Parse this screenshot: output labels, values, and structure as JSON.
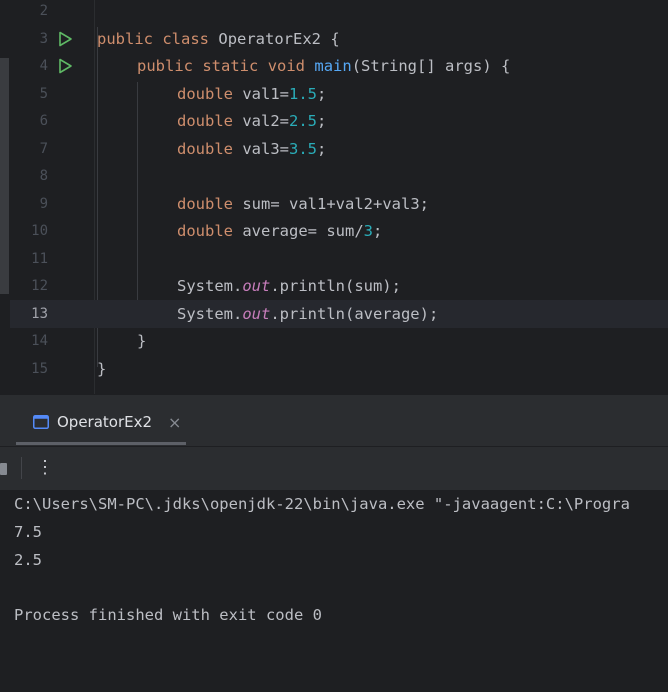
{
  "editor": {
    "lines": [
      {
        "n": "2"
      },
      {
        "n": "3"
      },
      {
        "n": "4"
      },
      {
        "n": "5"
      },
      {
        "n": "6"
      },
      {
        "n": "7"
      },
      {
        "n": "8"
      },
      {
        "n": "9"
      },
      {
        "n": "10"
      },
      {
        "n": "11"
      },
      {
        "n": "12"
      },
      {
        "n": "13"
      },
      {
        "n": "14"
      },
      {
        "n": "15"
      }
    ],
    "code": {
      "l3": {
        "kw1": "public",
        "kw2": "class",
        "name": "OperatorEx2",
        "brace": "{"
      },
      "l4": {
        "kw1": "public",
        "kw2": "static",
        "kw3": "void",
        "fn": "main",
        "params": "(String[] args) {"
      },
      "l5": {
        "type": "double",
        "var": "val1=",
        "num": "1.5",
        "end": ";"
      },
      "l6": {
        "type": "double",
        "var": "val2=",
        "num": "2.5",
        "end": ";"
      },
      "l7": {
        "type": "double",
        "var": "val3=",
        "num": "3.5",
        "end": ";"
      },
      "l9": {
        "type": "double",
        "rest": "sum= val1+val2+val3;"
      },
      "l10": {
        "type": "double",
        "var": "average= sum/",
        "num": "3",
        "end": ";"
      },
      "l12": {
        "pre": "System.",
        "field": "out",
        "post": ".println(sum);"
      },
      "l13": {
        "pre": "System.",
        "field": "out",
        "post": ".println(average);"
      },
      "l14": {
        "brace": "}"
      },
      "l15": {
        "brace": "}"
      }
    },
    "current_line": "13"
  },
  "run_window": {
    "tab_label": "OperatorEx2",
    "close_glyph": "×",
    "more_glyph": "⋮",
    "console": [
      "C:\\Users\\SM-PC\\.jdks\\openjdk-22\\bin\\java.exe \"-javaagent:C:\\Progra",
      "7.5",
      "2.5",
      "",
      "Process finished with exit code 0"
    ]
  },
  "colors": {
    "keyword": "#cf8e6d",
    "number": "#2aacb8",
    "function": "#56a8f5",
    "field": "#c77dbb",
    "run_arrow": "#5fb865",
    "background": "#1e1f22"
  }
}
